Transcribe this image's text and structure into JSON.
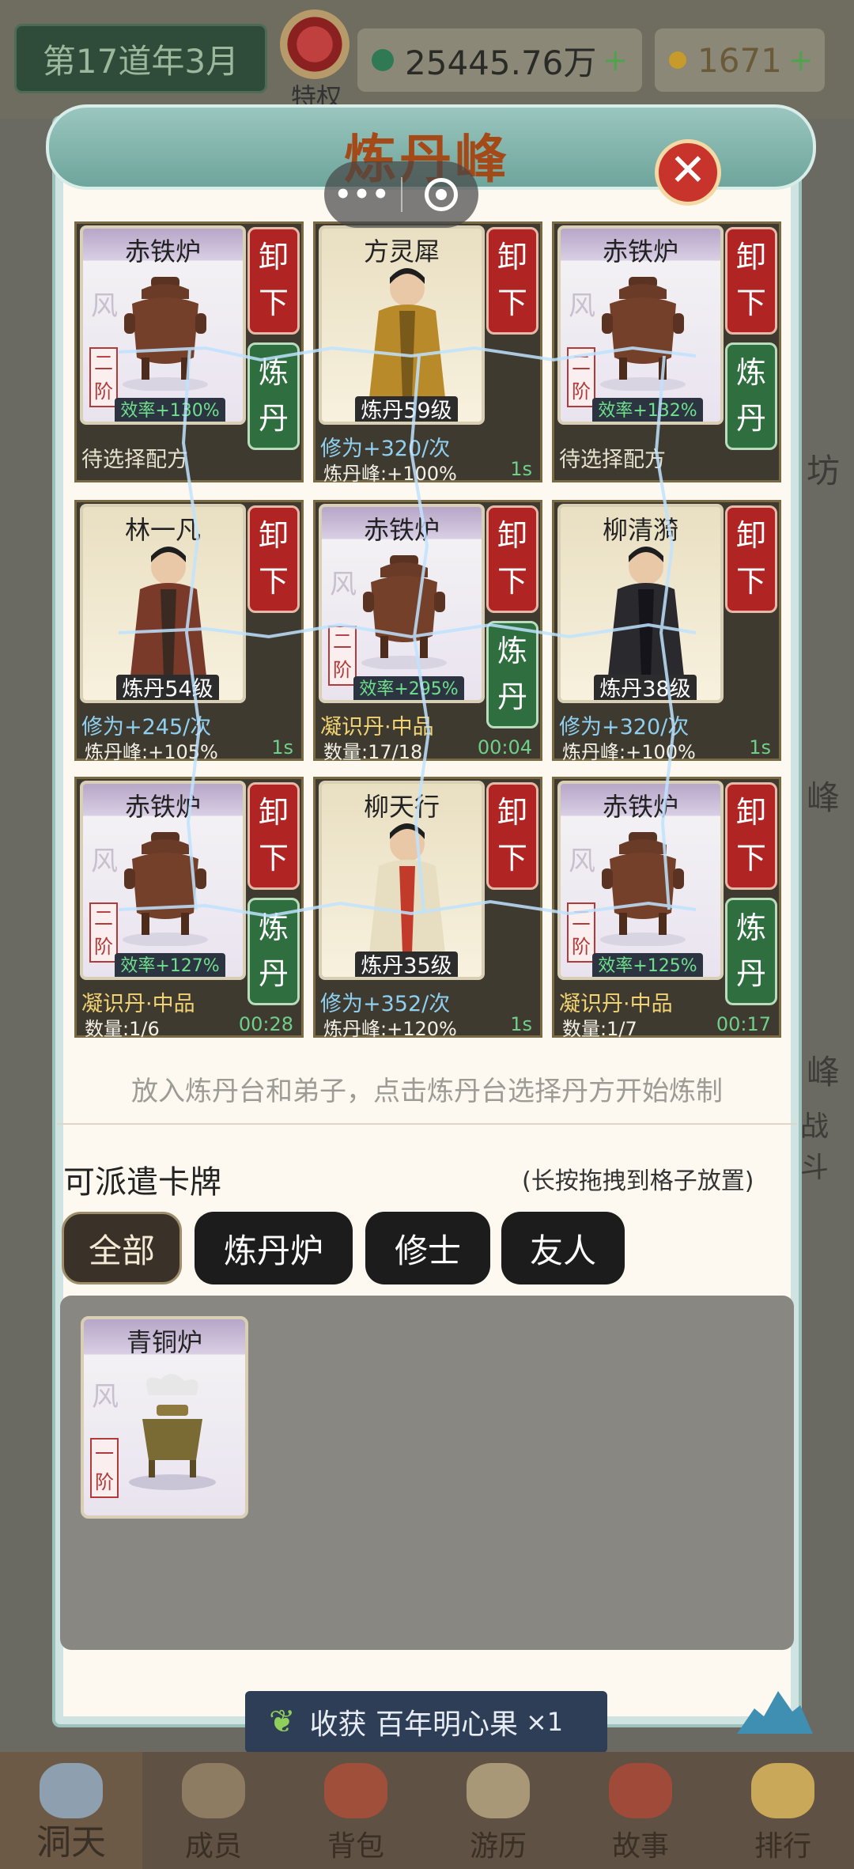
{
  "top_bar": {
    "date": "第17道年3月",
    "privilege_label": "特权",
    "spirit_stones": "25445.76万",
    "plus1": "+",
    "gold": "1671",
    "plus2": "+"
  },
  "background_labels": [
    "坊",
    "峰",
    "峰",
    "战斗"
  ],
  "modal": {
    "title": "炼丹峰",
    "close": "✕",
    "capsule": "•••"
  },
  "slots": [
    {
      "card_name": "赤铁炉",
      "type": "furnace",
      "tier": "二阶",
      "efficiency": "效率+130%",
      "btn_top": "卸下",
      "btn_bottom": "炼丹",
      "status": "待选择配方"
    },
    {
      "card_name": "方灵犀",
      "type": "hero",
      "level": "炼丹59级",
      "btn_top": "卸下",
      "gain": "修为+320/次",
      "peak": "炼丹峰:+100%",
      "time": "1s"
    },
    {
      "card_name": "赤铁炉",
      "type": "furnace",
      "tier": "二阶",
      "efficiency": "效率+132%",
      "btn_top": "卸下",
      "btn_bottom": "炼丹",
      "status": "待选择配方"
    },
    {
      "card_name": "林一凡",
      "type": "hero",
      "level": "炼丹54级",
      "btn_top": "卸下",
      "gain": "修为+245/次",
      "peak": "炼丹峰:+105%",
      "time": "1s"
    },
    {
      "card_name": "赤铁炉",
      "type": "furnace",
      "tier": "二阶",
      "efficiency": "效率+295%",
      "btn_top": "卸下",
      "btn_bottom": "炼丹",
      "pill": "凝识丹·中品",
      "count": "数量:17/18",
      "time": "00:04"
    },
    {
      "card_name": "柳清漪",
      "type": "hero",
      "level": "炼丹38级",
      "btn_top": "卸下",
      "gain": "修为+320/次",
      "peak": "炼丹峰:+100%",
      "time": "1s"
    },
    {
      "card_name": "赤铁炉",
      "type": "furnace",
      "tier": "二阶",
      "efficiency": "效率+127%",
      "btn_top": "卸下",
      "btn_bottom": "炼丹",
      "pill": "凝识丹·中品",
      "count": "数量:1/6",
      "time": "00:28"
    },
    {
      "card_name": "柳天行",
      "type": "hero",
      "level": "炼丹35级",
      "btn_top": "卸下",
      "gain": "修为+352/次",
      "peak": "炼丹峰:+120%",
      "time": "1s"
    },
    {
      "card_name": "赤铁炉",
      "type": "furnace",
      "tier": "二阶",
      "efficiency": "效率+125%",
      "btn_top": "卸下",
      "btn_bottom": "炼丹",
      "pill": "凝识丹·中品",
      "count": "数量:1/7",
      "time": "00:17"
    }
  ],
  "hint": "放入炼丹台和弟子，点击炼丹台选择丹方开始炼制",
  "deploy": {
    "title": "可派遣卡牌",
    "hint": "(长按拖拽到格子放置)",
    "tabs": [
      "全部",
      "炼丹炉",
      "修士",
      "友人"
    ],
    "cards": [
      {
        "name": "青铜炉",
        "tier": "一阶"
      }
    ]
  },
  "harvest": {
    "label": "收获 百年明心果",
    "amount": "×1"
  },
  "nav": [
    "洞天",
    "成员",
    "背包",
    "游历",
    "故事",
    "排行"
  ],
  "colors": {
    "primary_red": "#b02424",
    "primary_green": "#2f6f3f",
    "accent_blue": "#8fd0f0"
  }
}
